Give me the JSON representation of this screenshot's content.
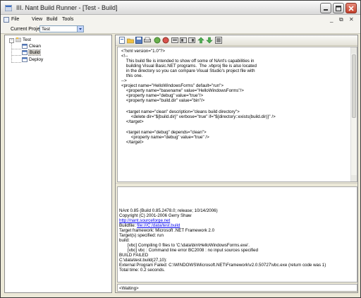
{
  "window": {
    "title": "III. Nant Build Runner - [Test - Build]"
  },
  "menu": {
    "items": [
      {
        "name": "menu-file",
        "label": "File"
      },
      {
        "name": "menu-view",
        "label": "View"
      },
      {
        "name": "menu-build",
        "label": "Build"
      },
      {
        "name": "menu-tools",
        "label": "Tools"
      }
    ],
    "controls": [
      "_",
      "⧉",
      "✕"
    ]
  },
  "project": {
    "label": "Current Project:",
    "selected": "Test"
  },
  "tree": {
    "root": "Test",
    "expander": "−",
    "children": [
      "Clean",
      "Build",
      "Deploy"
    ],
    "selected": "Build"
  },
  "editor": {
    "lines": [
      "<?xml version=\"1.0\"?>",
      "<!--",
      "    This build file is intended to show off some of NAnt's capabilities in",
      "    building Visual Basic.NET programs.  The .vbproj file is also located",
      "    in the directory so you can compare Visual Studio's project file with",
      "    this one.",
      "-->",
      "<project name=\"HelloWindowsForms\" default=\"run\">",
      "    <property name=\"basename\" value=\"HelloWindowsForms\"/>",
      "    <property name=\"debug\" value=\"true\"/>",
      "    <property name=\"build.dir\" value=\"bin\"/>",
      "",
      "    <target name=\"clean\" description=\"cleans build directory\">",
      "        <delete dir=\"${build.dir}\" verbose=\"true\" if=\"${directory::exists(build.dir)}\" />",
      "    </target>",
      "",
      "    <target name=\"debug\" depends=\"clean\">",
      "        <property name=\"debug\" value=\"true\" />",
      "    </target>"
    ]
  },
  "output": {
    "lines": [
      {
        "text": "NAnt 0.85 (Build 0.85.2478.0; release; 10/14/2006)"
      },
      {
        "text": "Copyright (C) 2001-2006 Gerry Shaw"
      },
      {
        "text": "http://nant.sourceforge.net",
        "link": true
      },
      {
        "prefix": "Buildfile: ",
        "text": "file:///C:/data/test.build",
        "link": true
      },
      {
        "text": "Target framework: Microsoft .NET Framework 2.0"
      },
      {
        "text": "Target(s) specified: run"
      },
      {
        "text": "build:"
      },
      {
        "text": "       [vbc] Compiling 0 files to 'C:\\data\\bin\\HelloWindowsForms.exe'."
      },
      {
        "text": "       [vbc] vbc : Command line error BC2008 : no input sources specified"
      },
      {
        "text": "BUILD FAILED"
      },
      {
        "text": "C:\\data\\test.build(27,10):"
      },
      {
        "text": "External Program Failed: C:\\WINDOWS\\Microsoft.NET\\Framework\\v2.0.50727\\vbc.exe (return code was 1)"
      },
      {
        "text": "Total time: 0.2 seconds."
      }
    ]
  },
  "status": {
    "text": "<Waiting>"
  },
  "toolbar": {
    "buttons": [
      "new-file-icon",
      "open-icon",
      "save-icon",
      "print-icon",
      "build-icon",
      "stop-icon",
      "list-icon",
      "properties-icon",
      "up-arrow-icon",
      "down-arrow-icon",
      "close-doc-icon"
    ]
  }
}
